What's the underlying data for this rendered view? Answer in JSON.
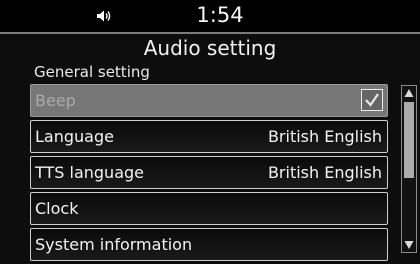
{
  "status_bar": {
    "volume_icon": "speaker-volume-icon",
    "time": "1:54"
  },
  "screen": {
    "title": "Audio setting",
    "section": "General setting"
  },
  "menu": {
    "items": [
      {
        "label": "Beep",
        "checked": true,
        "enabled": false
      },
      {
        "label": "Language",
        "value": "British English"
      },
      {
        "label": "TTS language",
        "value": "British English"
      },
      {
        "label": "Clock"
      },
      {
        "label": "System information"
      }
    ]
  },
  "scrollbar": {
    "up_icon": "triangle-up-icon",
    "down_icon": "triangle-down-icon"
  },
  "colors": {
    "background": "#0d0d0d",
    "disabled_row": "#777777",
    "border": "#cfcfcf"
  }
}
